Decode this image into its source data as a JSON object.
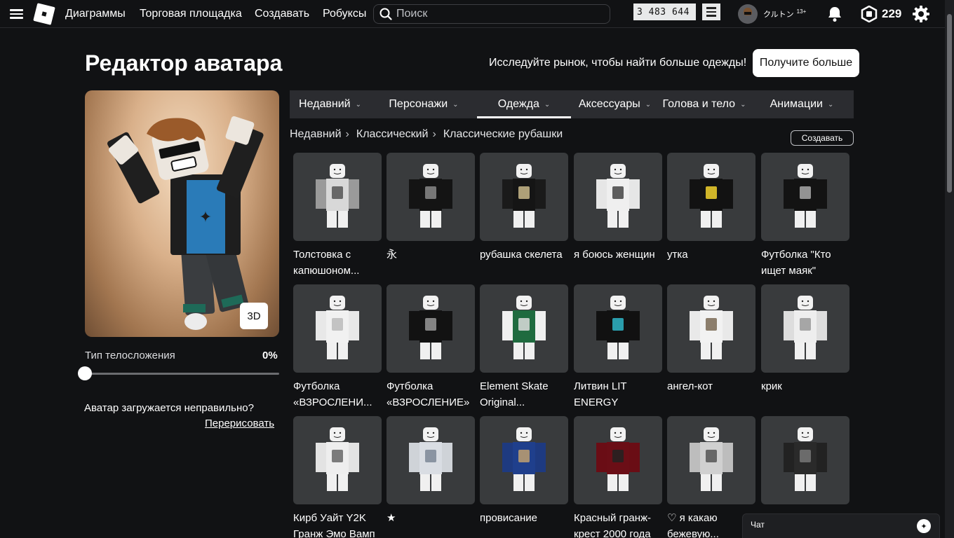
{
  "topbar": {
    "nav": [
      "Диаграммы",
      "Торговая площадка",
      "Создавать",
      "Робуксы"
    ],
    "search_placeholder": "Поиск",
    "counter_value": "3 483 644",
    "username": "クルトン",
    "age_badge": "13+",
    "robux_balance": "229"
  },
  "header": {
    "title": "Редактор аватара",
    "promo_text": "Исследуйте рынок, чтобы найти больше одежды!",
    "get_more_label": "Получите больше"
  },
  "preview": {
    "mode_label": "3D",
    "body_type_label": "Тип телосложения",
    "body_type_value": "0%",
    "body_type_fraction": 0,
    "loading_issue_text": "Аватар загружается неправильно?",
    "redraw_label": "Перерисовать"
  },
  "tabs": [
    {
      "label": "Недавний",
      "active": false
    },
    {
      "label": "Персонажи",
      "active": false
    },
    {
      "label": "Одежда",
      "active": true
    },
    {
      "label": "Аксессуары",
      "active": false
    },
    {
      "label": "Голова и тело",
      "active": false
    },
    {
      "label": "Анимации",
      "active": false
    }
  ],
  "breadcrumb": [
    "Недавний",
    "Классический",
    "Классические рубашки"
  ],
  "create_label": "Создавать",
  "items": [
    {
      "name": "Толстовка с капюшоном...",
      "shirt": "#d8d8d8",
      "sleeve": "#9a9a9a",
      "print": "#555"
    },
    {
      "name": "永",
      "shirt": "#141414",
      "sleeve": "#141414",
      "print": "#888"
    },
    {
      "name": "рубашка скелета",
      "shirt": "#151515",
      "sleeve": "#1a1a1a",
      "print": "#c9b98a"
    },
    {
      "name": "я боюсь женщин",
      "shirt": "#efefef",
      "sleeve": "#e6e6e6",
      "print": "#444"
    },
    {
      "name": "утка",
      "shirt": "#121212",
      "sleeve": "#121212",
      "print": "#f2d22e"
    },
    {
      "name": "Футболка \"Кто ищет маяк\"",
      "shirt": "#131313",
      "sleeve": "#131313",
      "print": "#aaa"
    },
    {
      "name": "Футболка «ВЗРОСЛЕНИ...",
      "shirt": "#f1f1f1",
      "sleeve": "#e8e8e8",
      "print": "#bbb"
    },
    {
      "name": "Футболка «ВЗРОСЛЕНИЕ»",
      "shirt": "#121212",
      "sleeve": "#121212",
      "print": "#999"
    },
    {
      "name": "Element Skate Original...",
      "shirt": "#1f6b3f",
      "sleeve": "#f0f0f0",
      "print": "#ddd"
    },
    {
      "name": "Литвин LIT ENERGY",
      "shirt": "#111",
      "sleeve": "#111",
      "print": "#2fb6c8"
    },
    {
      "name": "ангел-кот",
      "shirt": "#f2f2f2",
      "sleeve": "#e9e9e9",
      "print": "#7a6a55"
    },
    {
      "name": "крик",
      "shirt": "#eeeeee",
      "sleeve": "#dddddd",
      "print": "#999"
    },
    {
      "name": "Кирб Уайт Y2K Гранж Эмо Вамп",
      "shirt": "#eeeeee",
      "sleeve": "#e3e3e3",
      "print": "#666"
    },
    {
      "name": "★",
      "shirt": "#d9dde3",
      "sleeve": "#cfd3d8",
      "print": "#7b8796"
    },
    {
      "name": "провисание",
      "shirt": "#1f3f8c",
      "sleeve": "#1e3a80",
      "print": "#c0a070"
    },
    {
      "name": "Красный гранж-крест 2000 года",
      "shirt": "#6b0e16",
      "sleeve": "#6a0d15",
      "print": "#222"
    },
    {
      "name": "♡ я какаю бежевую...",
      "shirt": "#d0d0d0",
      "sleeve": "#bdbdbd",
      "print": "#555"
    },
    {
      "name": "",
      "shirt": "#2a2a2a",
      "sleeve": "#222",
      "print": "#777"
    }
  ],
  "chat": {
    "label": "Чат"
  }
}
